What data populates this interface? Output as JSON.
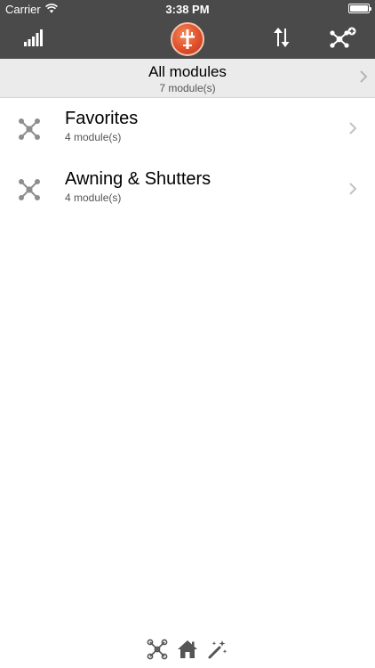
{
  "status_bar": {
    "carrier": "Carrier",
    "time": "3:38 PM"
  },
  "nav_bar": {
    "left_icon": "signal-strength-icon",
    "center_icon": "app-logo-icon",
    "sort_icon": "sort-arrows-icon",
    "right_icon": "network-add-icon"
  },
  "all_modules": {
    "title": "All modules",
    "subtitle": "7 module(s)"
  },
  "groups": [
    {
      "title": "Favorites",
      "subtitle": "4 module(s)",
      "icon": "network-icon"
    },
    {
      "title": "Awning & Shutters",
      "subtitle": "4 module(s)",
      "icon": "network-icon"
    }
  ],
  "bottom_bar": {
    "icons": [
      "network-tab-icon",
      "home-tab-icon",
      "magic-wand-tab-icon"
    ]
  },
  "colors": {
    "bar_background": "#4a4a4a",
    "header_background": "#ebebeb",
    "icon_gray": "#8e8e8e",
    "logo_red": "#e0502a"
  }
}
